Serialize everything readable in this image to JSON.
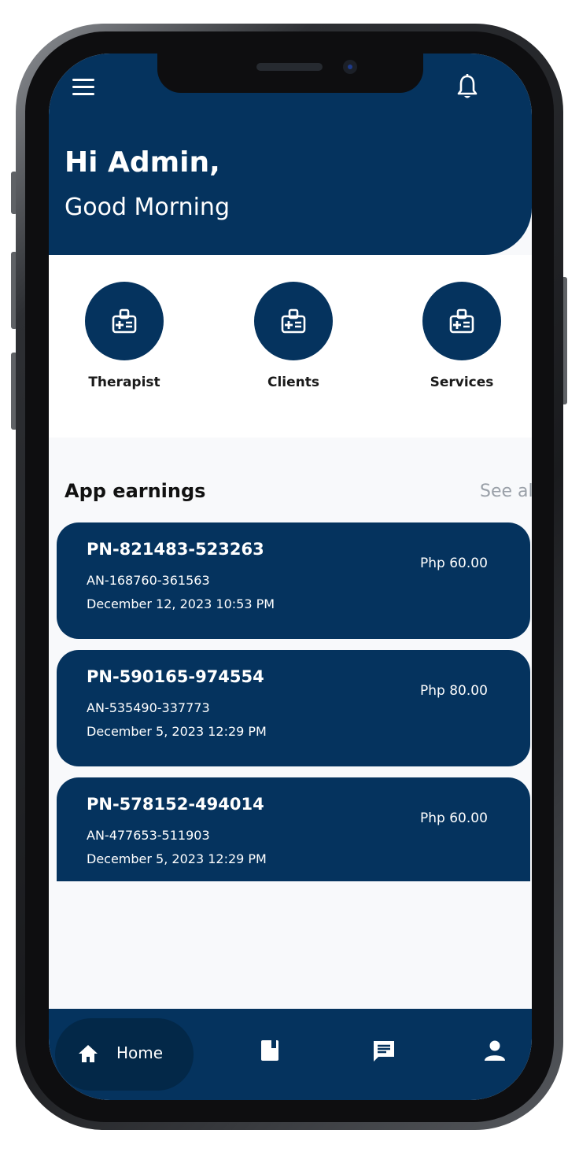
{
  "header": {
    "greeting": "Hi Admin,",
    "subtitle": "Good Morning"
  },
  "shortcuts": [
    {
      "label": "Therapist",
      "icon": "medical-badge-icon"
    },
    {
      "label": "Clients",
      "icon": "medical-badge-icon"
    },
    {
      "label": "Services",
      "icon": "medical-badge-icon"
    }
  ],
  "earnings": {
    "title": "App earnings",
    "see_all": "See all",
    "items": [
      {
        "pn": "PN-821483-523263",
        "an": "AN-168760-361563",
        "date": "December 12, 2023 10:53 PM",
        "amount": "Php 60.00"
      },
      {
        "pn": "PN-590165-974554",
        "an": "AN-535490-337773",
        "date": "December 5, 2023 12:29 PM",
        "amount": "Php 80.00"
      },
      {
        "pn": "PN-578152-494014",
        "an": "AN-477653-511903",
        "date": "December 5, 2023 12:29 PM",
        "amount": "Php 60.00"
      }
    ]
  },
  "nav": {
    "home_label": "Home",
    "items": [
      "home-icon",
      "book-icon",
      "chat-icon",
      "person-icon"
    ]
  },
  "colors": {
    "primary": "#05335e",
    "nav_active": "#032848",
    "see_all": "#9aa0a8"
  }
}
